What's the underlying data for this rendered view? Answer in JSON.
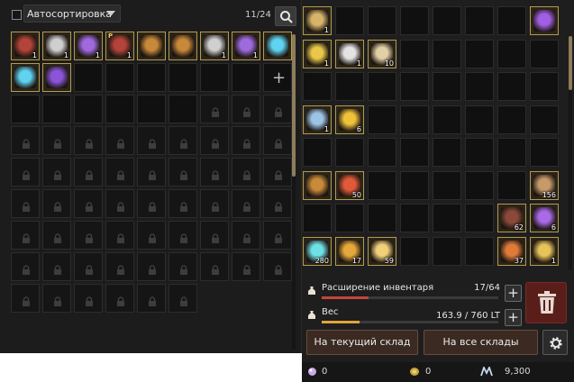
{
  "storage": {
    "autosort_label": "Автосортировка",
    "autosort_checked": false,
    "slot_count": "11/24",
    "search_icon": "search-icon",
    "items": [
      {
        "art": "red-backpack",
        "color": "#b4443a",
        "qty": "1",
        "prem": ""
      },
      {
        "art": "silver-tree",
        "color": "#cfcfcf",
        "qty": "1",
        "prem": ""
      },
      {
        "art": "purple-orb",
        "color": "#a06adf",
        "qty": "1",
        "prem": ""
      },
      {
        "art": "red-backpack",
        "color": "#b4443a",
        "qty": "1",
        "prem": "P"
      },
      {
        "art": "treasure-chest",
        "color": "#c9893a",
        "qty": "",
        "prem": ""
      },
      {
        "art": "treasure-chest",
        "color": "#c9893a",
        "qty": "",
        "prem": ""
      },
      {
        "art": "silver-tree",
        "color": "#cfcfcf",
        "qty": "1",
        "prem": ""
      },
      {
        "art": "purple-orb",
        "color": "#a06adf",
        "qty": "1",
        "prem": ""
      },
      {
        "art": "blue-flame",
        "color": "#5fd3f0",
        "qty": "",
        "prem": ""
      },
      {
        "art": "blue-flame",
        "color": "#5fd3f0",
        "qty": "",
        "prem": ""
      },
      {
        "art": "purple-spikes",
        "color": "#8a55d8",
        "qty": "",
        "prem": ""
      }
    ],
    "empty_slots": 13,
    "add_slot_index": 6,
    "locked_slots": 54
  },
  "inventory": {
    "slots": [
      {
        "art": "scroll",
        "color": "#d7b46a",
        "qty": "1"
      },
      null,
      null,
      null,
      null,
      null,
      null,
      {
        "art": "purple-feather",
        "color": "#a15fe3",
        "qty": ""
      },
      {
        "art": "gold-coupon",
        "color": "#e8c74a",
        "qty": "1"
      },
      {
        "art": "white-bag",
        "color": "#e3e3e3",
        "qty": "1"
      },
      {
        "art": "map-scroll",
        "color": "#e1cfa5",
        "qty": "10"
      },
      null,
      null,
      null,
      null,
      null,
      null,
      null,
      null,
      null,
      null,
      null,
      null,
      null,
      {
        "art": "blue-vial",
        "color": "#9cc4e6",
        "qty": "1"
      },
      {
        "art": "gold-crystal",
        "color": "#f0c23a",
        "qty": "6"
      },
      null,
      null,
      null,
      null,
      null,
      null,
      null,
      null,
      null,
      null,
      null,
      null,
      null,
      null,
      {
        "art": "sword-ix",
        "color": "#c98a3a",
        "qty": ""
      },
      {
        "art": "red-ore",
        "color": "#e05a3a",
        "qty": "50"
      },
      null,
      null,
      null,
      null,
      null,
      {
        "art": "brown-horn",
        "color": "#c79a6a",
        "qty": "156"
      },
      null,
      null,
      null,
      null,
      null,
      null,
      {
        "art": "brown-leather",
        "color": "#8a4a3a",
        "qty": "62"
      },
      {
        "art": "purple-gem",
        "color": "#a86ae6",
        "qty": "6"
      },
      {
        "art": "cyan-orb",
        "color": "#6fe0e6",
        "qty": "280"
      },
      {
        "art": "gold-emblem",
        "color": "#e6a83a",
        "qty": "17"
      },
      {
        "art": "gold-disc",
        "color": "#f0d07a",
        "qty": "59"
      },
      null,
      null,
      null,
      {
        "art": "carrot-potion",
        "color": "#e07a3a",
        "qty": "37"
      },
      {
        "art": "food-bowl",
        "color": "#e6c45a",
        "qty": "1"
      }
    ]
  },
  "expansion": {
    "label": "Расширение инвентаря",
    "value": "17/64",
    "fraction": 0.266,
    "color": "#c2473a"
  },
  "weight": {
    "label": "Вес",
    "value": "163.9 / 760 LT",
    "fraction": 0.216,
    "color": "#e0a53a"
  },
  "buttons": {
    "current_storage": "На текущий склад",
    "all_storages": "На все склады",
    "trash_icon": "trash-icon",
    "settings_icon": "gear-icon"
  },
  "currency": {
    "pearls": "0",
    "coins": "0",
    "points": "9,300"
  }
}
